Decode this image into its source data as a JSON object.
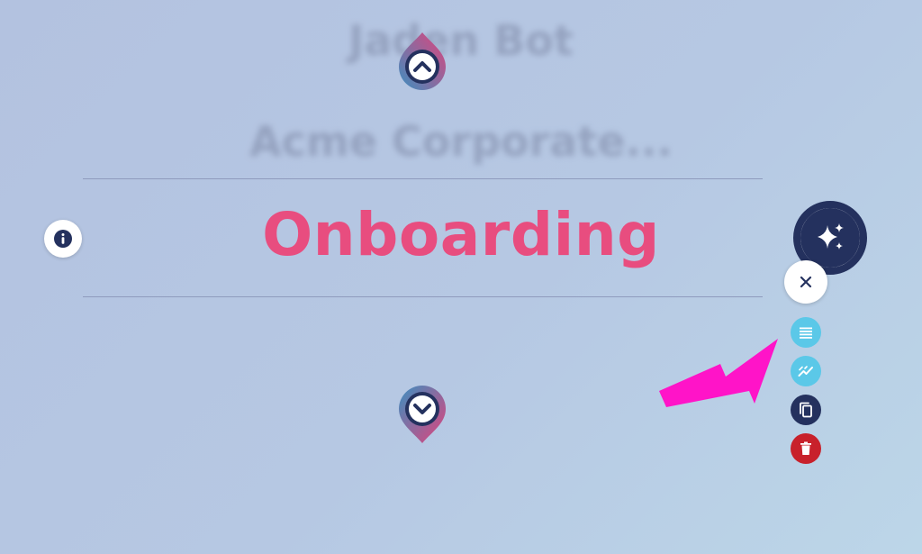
{
  "header": {
    "bot_name": "Jaden Bot",
    "company_name": "Acme Corporate..."
  },
  "main": {
    "title": "Onboarding"
  },
  "icons": {
    "pin_up": "chevron-up-pin-icon",
    "pin_down": "chevron-down-pin-icon",
    "info": "info-icon",
    "ai": "sparkles-icon",
    "close": "close-icon",
    "list": "list-icon",
    "analytics": "analytics-icon",
    "copy": "copy-icon",
    "delete": "trash-icon",
    "annotation": "arrow-annotation"
  },
  "colors": {
    "title": "#e84d7f",
    "navy": "#24315e",
    "cyan": "#5bc8e8",
    "red": "#c8212b",
    "arrow": "#ff14c8",
    "pin_start": "#3b8fc0",
    "pin_end": "#e2427b"
  }
}
